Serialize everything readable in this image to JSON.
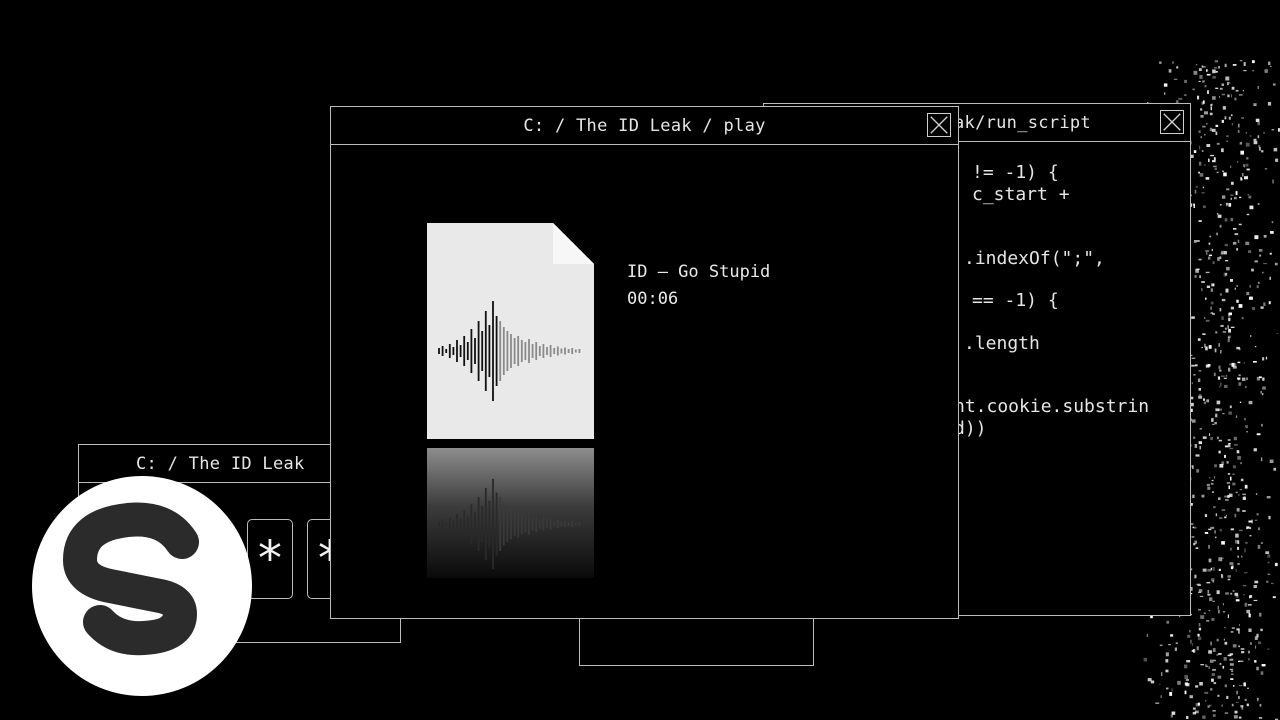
{
  "windows": {
    "code": {
      "title": "ak/run_script",
      "lines": [
        "!= -1) {",
        "c_start +",
        ".indexOf(\";\",",
        "== -1) {",
        ".length",
        "nt.cookie.substrin",
        "d))"
      ]
    },
    "leak": {
      "title": "C: / The ID Leak",
      "password_chars": [
        "*",
        "*"
      ]
    },
    "player": {
      "title": "C: / The ID Leak / play",
      "track": {
        "title": "ID – Go Stupid",
        "time": "00:06"
      }
    }
  },
  "icons": {
    "close": "close-icon",
    "file": "audio-file-icon",
    "logo": "spinnin-logo"
  },
  "colors": {
    "background": "#000000",
    "border": "#bdbdbd",
    "text": "#e8e8e8",
    "file": "#e9e9e9",
    "logo_bg": "#ffffff",
    "logo_mark": "#2b2b2b"
  }
}
